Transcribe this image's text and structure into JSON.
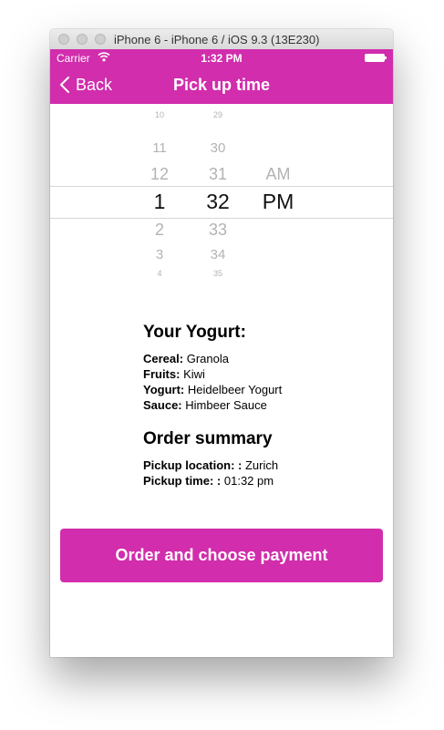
{
  "window": {
    "title": "iPhone 6 - iPhone 6 / iOS 9.3 (13E230)"
  },
  "status_bar": {
    "carrier": "Carrier",
    "time": "1:32 PM"
  },
  "nav": {
    "back_label": "Back",
    "title": "Pick up time"
  },
  "picker": {
    "hours": [
      "10",
      "11",
      "12",
      "1",
      "2",
      "3",
      "4"
    ],
    "minutes": [
      "29",
      "30",
      "31",
      "32",
      "33",
      "34",
      "35"
    ],
    "ampm": [
      "AM",
      "PM"
    ],
    "selected": {
      "hour": "1",
      "minute": "32",
      "ampm": "PM"
    }
  },
  "yogurt": {
    "heading": "Your Yogurt:",
    "items": [
      {
        "label": "Cereal:",
        "value": "Granola"
      },
      {
        "label": "Fruits:",
        "value": "Kiwi"
      },
      {
        "label": "Yogurt:",
        "value": "Heidelbeer Yogurt"
      },
      {
        "label": "Sauce:",
        "value": "Himbeer Sauce"
      }
    ]
  },
  "order_summary": {
    "heading": "Order summary",
    "items": [
      {
        "label": "Pickup location: :",
        "value": "Zurich"
      },
      {
        "label": "Pickup time: :",
        "value": "01:32 pm"
      }
    ]
  },
  "action": {
    "label": "Order and choose payment"
  },
  "colors": {
    "accent": "#d12dac"
  }
}
